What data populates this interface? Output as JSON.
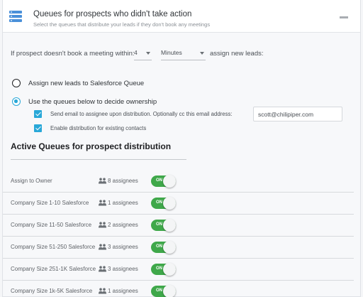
{
  "header": {
    "title": "Queues for prospects who didn't take action",
    "subtitle": "Select the queues that distribute your leads if they don't book any meetings",
    "icon": "server-stack-icon",
    "accent_color": "#4a90d9"
  },
  "timeout": {
    "prefix": "If prospect doesn't book a meeting within:",
    "amount": "4",
    "unit": "Minutes",
    "suffix": "assign new leads:"
  },
  "options": {
    "assign_salesforce": "Assign new leads to Salesforce Queue",
    "use_queues": "Use the queues below to decide ownership",
    "selected": "use_queues",
    "send_email_label": "Send email to assignee upon distribution. Optionally cc this email address:",
    "send_email_checked": true,
    "cc_email": "scott@chilipiper.com",
    "existing_contacts_label": "Enable distribution for existing contacts",
    "existing_contacts_checked": true
  },
  "queues": {
    "title": "Active Queues for prospect distribution",
    "toggle_label": "ON",
    "toggle_color": "#3fa84a",
    "items": [
      {
        "name": "Assign to Owner",
        "assignees": "8 assignees",
        "enabled": true
      },
      {
        "name": "Company Size 1-10 Salesforce",
        "assignees": "1 assignees",
        "enabled": true
      },
      {
        "name": "Company Size 11-50 Salesforce",
        "assignees": "2 assignees",
        "enabled": true
      },
      {
        "name": "Company Size 51-250 Salesforce",
        "assignees": "3 assignees",
        "enabled": true
      },
      {
        "name": "Company Size 251-1K Salesforce",
        "assignees": "3 assignees",
        "enabled": true
      },
      {
        "name": "Company Size 1k-5K Salesforce",
        "assignees": "1 assignees",
        "enabled": true
      }
    ]
  }
}
